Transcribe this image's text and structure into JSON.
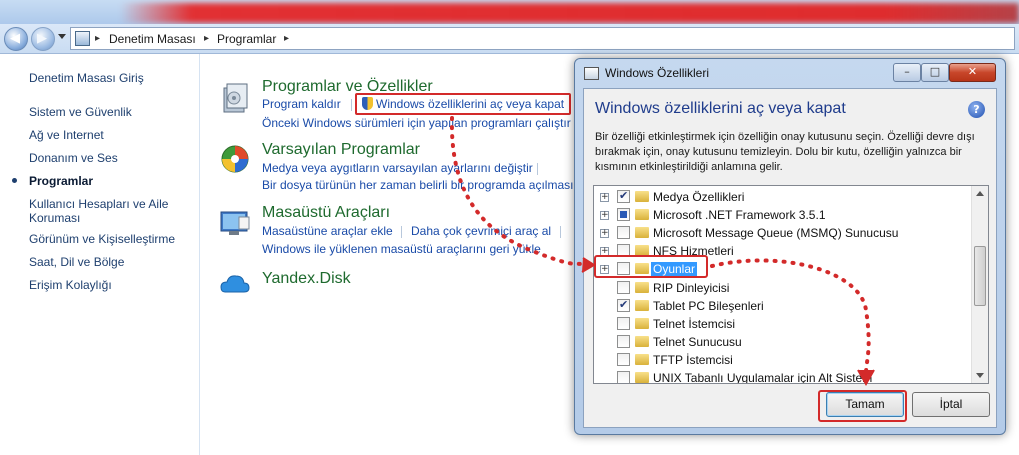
{
  "address": {
    "crumbs": [
      "Denetim Masası",
      "Programlar"
    ],
    "separator": "▸"
  },
  "sidebar": {
    "items": [
      {
        "label": "Denetim Masası Giriş"
      },
      {
        "label": "Sistem ve Güvenlik"
      },
      {
        "label": "Ağ ve Internet"
      },
      {
        "label": "Donanım ve Ses"
      },
      {
        "label": "Programlar",
        "active": true
      },
      {
        "label": "Kullanıcı Hesapları ve Aile Koruması"
      },
      {
        "label": "Görünüm ve Kişiselleştirme"
      },
      {
        "label": "Saat, Dil ve Bölge"
      },
      {
        "label": "Erişim Kolaylığı"
      }
    ]
  },
  "categories": {
    "programs": {
      "title": "Programlar ve Özellikler",
      "uninstall": "Program kaldır",
      "features": "Windows özelliklerini aç veya kapat",
      "compat": "Önceki Windows sürümleri için yapılan programları çalıştır"
    },
    "defaults": {
      "title": "Varsayılan Programlar",
      "change_media": "Medya veya aygıtların varsayılan ayarlarını değiştir",
      "always_open": "Bir dosya türünün her zaman belirli bir programda açılması"
    },
    "gadgets": {
      "title": "Masaüstü Araçları",
      "add": "Masaüstüne araçlar ekle",
      "more_online": "Daha çok çevrimiçi araç al",
      "restore": "Windows ile yüklenen masaüstü araçlarını geri yükle"
    },
    "yandex": {
      "title": "Yandex.Disk"
    }
  },
  "dialog": {
    "title": "Windows Özellikleri",
    "heading": "Windows özelliklerini aç veya kapat",
    "help": "?",
    "description": "Bir özelliği etkinleştirmek için özelliğin onay kutusunu seçin. Özelliği devre dışı bırakmak için, onay kutusunu temizleyin. Dolu bir kutu, özelliğin yalnızca bir kısmının etkinleştirildiği anlamına gelir.",
    "features": [
      {
        "label": "Medya Özellikleri",
        "expandable": true,
        "state": "checked"
      },
      {
        "label": "Microsoft .NET Framework 3.5.1",
        "expandable": true,
        "state": "partial"
      },
      {
        "label": "Microsoft Message Queue (MSMQ) Sunucusu",
        "expandable": true,
        "state": "unchecked"
      },
      {
        "label": "NFS Hizmetleri",
        "expandable": true,
        "state": "unchecked"
      },
      {
        "label": "Oyunlar",
        "expandable": true,
        "state": "unchecked",
        "selected": true
      },
      {
        "label": "RIP Dinleyicisi",
        "expandable": false,
        "state": "unchecked"
      },
      {
        "label": "Tablet PC Bileşenleri",
        "expandable": false,
        "state": "checked"
      },
      {
        "label": "Telnet İstemcisi",
        "expandable": false,
        "state": "unchecked"
      },
      {
        "label": "Telnet Sunucusu",
        "expandable": false,
        "state": "unchecked"
      },
      {
        "label": "TFTP İstemcisi",
        "expandable": false,
        "state": "unchecked"
      },
      {
        "label": "UNIX Tabanlı Uygulamalar için Alt Sistem",
        "expandable": false,
        "state": "unchecked"
      }
    ],
    "ok_label": "Tamam",
    "cancel_label": "İptal"
  },
  "colors": {
    "highlight": "#d32a2a",
    "link": "#1a4ba8",
    "category_title": "#1e6a2e",
    "selection": "#3399ff"
  }
}
